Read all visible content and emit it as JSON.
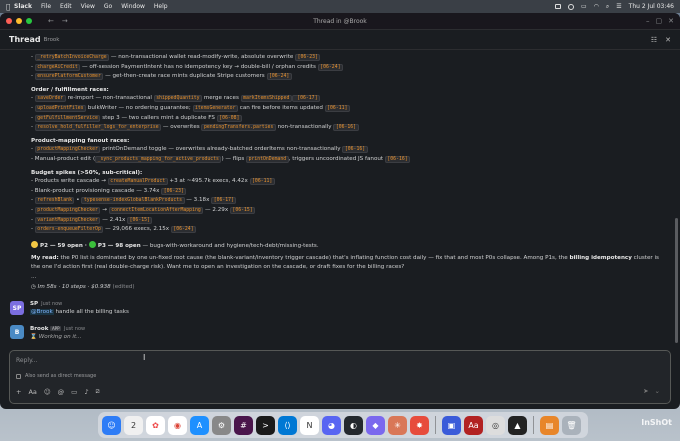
{
  "menubar": {
    "app": "Slack",
    "items": [
      "File",
      "Edit",
      "View",
      "Go",
      "Window",
      "Help"
    ],
    "datetime": "Thu 2 Jul  03:46"
  },
  "window": {
    "title": "Thread in @Brook"
  },
  "thread": {
    "title": "Thread",
    "channel": "Brook"
  },
  "body": {
    "lines_top": [
      {
        "code": "_retryBatchInvoiceCharge",
        "text": " — non-transactional wallet read-modify-write, absolute overwrite ",
        "tag": "[06-23]"
      },
      {
        "code": "chargeAiCredit",
        "text": " — off-session PaymentIntent has no idempotency key → double-bill / orphan credits ",
        "tag": "[06-24]"
      },
      {
        "code": "ensurePlatformCustomer",
        "text": " — get-then-create race mints duplicate Stripe customers ",
        "tag": "[06-24]"
      }
    ],
    "order_title": "Order / fulfillment races:",
    "order_l1": {
      "code1": "saveOrder",
      "t1": " re-import — non-transactional ",
      "code2": "shippedQuantity",
      "t2": " merge races ",
      "code3": "markItemsShipped",
      "tag": " [06-17]"
    },
    "order_l2": {
      "code1": "uploadPrintFiles",
      "t1": " bulkWriter — no ordering guarantee; ",
      "code2": "itemsGenerator",
      "t2": " can fire before items updated ",
      "tag": "[06-11]"
    },
    "order_l3": {
      "code1": "getFulfillmentService",
      "t1": " step 3 — two callers mint a duplicate FS ",
      "tag": "[06-08]"
    },
    "order_l4": {
      "code1": "resolve_hold_fulfiller_logs_for_enterprise",
      "t1": " — overwrites ",
      "code2": "pendingTransfers.parties",
      "t2": " non-transactionally ",
      "tag": "[06-16]"
    },
    "pm_title": "Product-mapping fanout races:",
    "pm_l1": {
      "code1": "productMappingChecker",
      "t1": " printOnDemand toggle — overwrites already-batched orderItems non-transactionally ",
      "tag": "[06-16]"
    },
    "pm_l2": {
      "t0": "- Manual-product edit (",
      "code1": "_sync_products_mapping_for_active_products",
      "t1": ") — flips ",
      "code2": "printOnDemand",
      "t2": ", triggers uncoordinated JS fanout ",
      "tag": "[06-16]"
    },
    "budget_title": "Budget spikes (>50%, sub-critical):",
    "budget": [
      {
        "pre": "- Products write cascade → ",
        "code": "createManualProduct",
        "val": " +3 at ~495.7k execs, 4.42x ",
        "tag": "[06-11]"
      },
      {
        "pre": "- Blank-product provisioning cascade — ",
        "code": "",
        "val": "3.74x ",
        "tag": "[06-23]"
      },
      {
        "pre": "- ",
        "code": "refreshBlank",
        "val": " • ",
        "code2": "typesense-indexGlobalBlankProducts",
        "val2": " — 3.18x ",
        "tag": "[06-17]"
      },
      {
        "pre": "- ",
        "code": "productMappingChecker",
        "val": " → ",
        "code2": "connectItemLocationAfterMapping",
        "val2": " — 2.29x ",
        "tag": "[06-15]"
      },
      {
        "pre": "- ",
        "code": "variantMappingChecker",
        "val": " — 2.41x ",
        "tag": "[06-15]"
      },
      {
        "pre": "- ",
        "code": "orders-enqueueFilterOp",
        "val": " — 29,066 execs, 2.15x ",
        "tag": "[06-24]"
      }
    ],
    "p2_label": "P2 — 59 open · ",
    "p3_label": "P3 — 98 open",
    "p_rest": " — bugs-with-workaround and hygiene/tech-debt/missing-tests.",
    "read_prefix": "My read:",
    "read_text1": " the P0 list is dominated by one un-fixed root cause (the blank-variant/inventory trigger cascade) that's inflating function cost daily — fix that and most P0s collapse. Among P1s, the ",
    "read_bold": "billing idempotency",
    "read_text2": " cluster is the one I'd action first (real double-charge risk). Want me to open an investigation on the cascade, or draft fixes for the billing races?",
    "ellipsis": "...",
    "stats": "Im 58s · 10 steps · $0.938",
    "edited": "(edited)"
  },
  "messages": [
    {
      "avatar": "SP",
      "name": "SP",
      "time": "Just now",
      "mention": "@Brook",
      "text": " handle all the billing tasks"
    },
    {
      "avatar": "B",
      "name": "Brook",
      "app_tag": "APP",
      "time": "Just now",
      "text": "Working on it..."
    }
  ],
  "composer": {
    "placeholder": "Reply...",
    "also_send": "Also send as direct message"
  },
  "watermark": "InShOt"
}
